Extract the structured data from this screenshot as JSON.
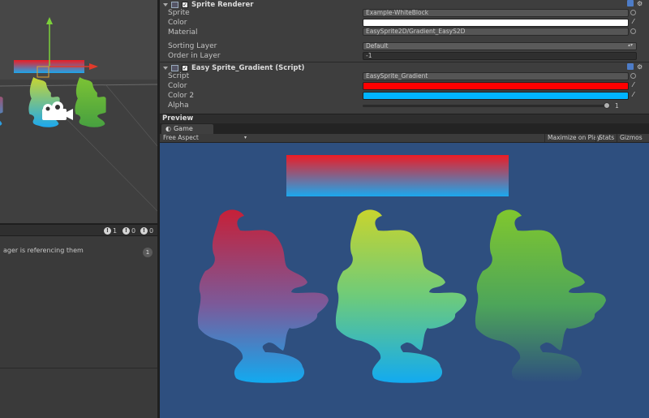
{
  "inspector": {
    "sprite_renderer": {
      "title": "Sprite Renderer",
      "rows": {
        "sprite": {
          "label": "Sprite",
          "value": "Example-WhiteBlock"
        },
        "color": {
          "label": "Color",
          "value": "#ffffff"
        },
        "material": {
          "label": "Material",
          "value": "EasySprite2D/Gradient_EasyS2D"
        },
        "sorting_layer": {
          "label": "Sorting Layer",
          "value": "Default"
        },
        "order_in_layer": {
          "label": "Order in Layer",
          "value": "-1"
        }
      }
    },
    "gradient_script": {
      "title": "Easy Sprite_Gradient (Script)",
      "rows": {
        "script": {
          "label": "Script",
          "value": "EasySprite_Gradient"
        },
        "color": {
          "label": "Color",
          "value": "#ff0000"
        },
        "color2": {
          "label": "Color 2",
          "value": "#00b4ff"
        },
        "alpha": {
          "label": "Alpha",
          "value": "1",
          "fraction": 1.0
        }
      }
    }
  },
  "preview": {
    "title": "Preview"
  },
  "game": {
    "tab_label": "Game",
    "aspect": "Free Aspect",
    "toolbar": {
      "maximize": "Maximize on Play",
      "stats": "Stats",
      "gizmos": "Gizmos"
    },
    "colors": {
      "background": "#2e4f7f",
      "gradient_top": "#ed1c24",
      "gradient_bottom": "#1ca8ee"
    }
  },
  "console": {
    "counts": {
      "info": "1",
      "warning": "0",
      "error": "0"
    },
    "message": "ager is referencing them",
    "message_count": "1"
  }
}
